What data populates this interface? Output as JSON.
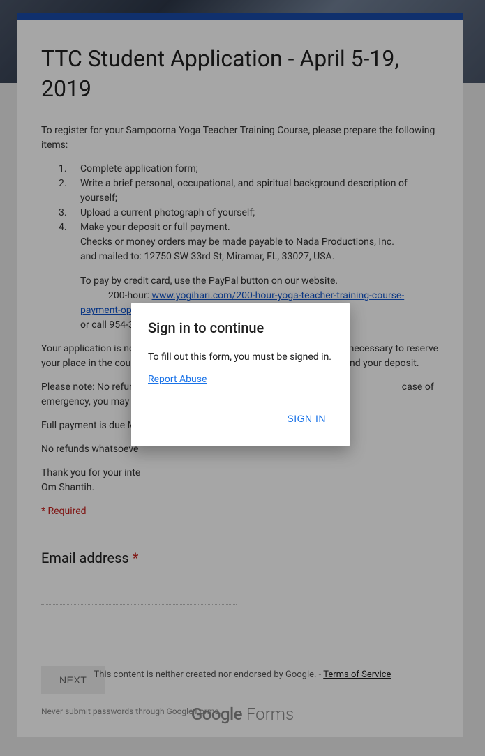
{
  "form": {
    "title": "TTC Student Application - April 5-19, 2019",
    "intro": "To register for your Sampoorna Yoga Teacher Training Course, please prepare the following items:",
    "list": [
      "Complete application form;",
      "Write a brief personal, occupational, and spiritual background description of yourself;",
      "Upload a current photograph of yourself;",
      "Make your deposit or full payment."
    ],
    "sub1": "Checks or money orders may be made payable to Nada Productions, Inc.",
    "sub2": "and mailed to: 12750 SW 33rd St, Miramar, FL, 33027, USA.",
    "sub3": "To pay by credit card, use the PayPal button on our website.",
    "sub4_label": "200-hour: ",
    "sub4_link": "www.yogihari.com/200-hour-yoga-teacher-training-course-payment-options/",
    "sub5": "or call 954-399-8000.",
    "para2a": "Your application is not complete until we receive your deposit, which is necessary to reserve your place in the course. If your application is not approved, we will refund your deposit.",
    "para3_partial": "Please note:  No refund",
    "para3_partial2": "case of emergency, you may transfer your d",
    "para4": "Full payment is due Ma",
    "para5": "No refunds whatsoeve",
    "para6a": "Thank you for your inte",
    "para6b": "Om Shantih.",
    "required_note": "* Required",
    "email_label": "Email address ",
    "email_value": "",
    "next": "NEXT",
    "pw_note": "Never submit passwords through Google Forms."
  },
  "footer": {
    "disclaimer": "This content is neither created nor endorsed by Google. - ",
    "tos": "Terms of Service",
    "logo_g": "Google",
    "logo_f": " Forms"
  },
  "modal": {
    "title": "Sign in to continue",
    "body": "To fill out this form, you must be signed in.",
    "report": "Report Abuse",
    "signin": "SIGN IN"
  }
}
